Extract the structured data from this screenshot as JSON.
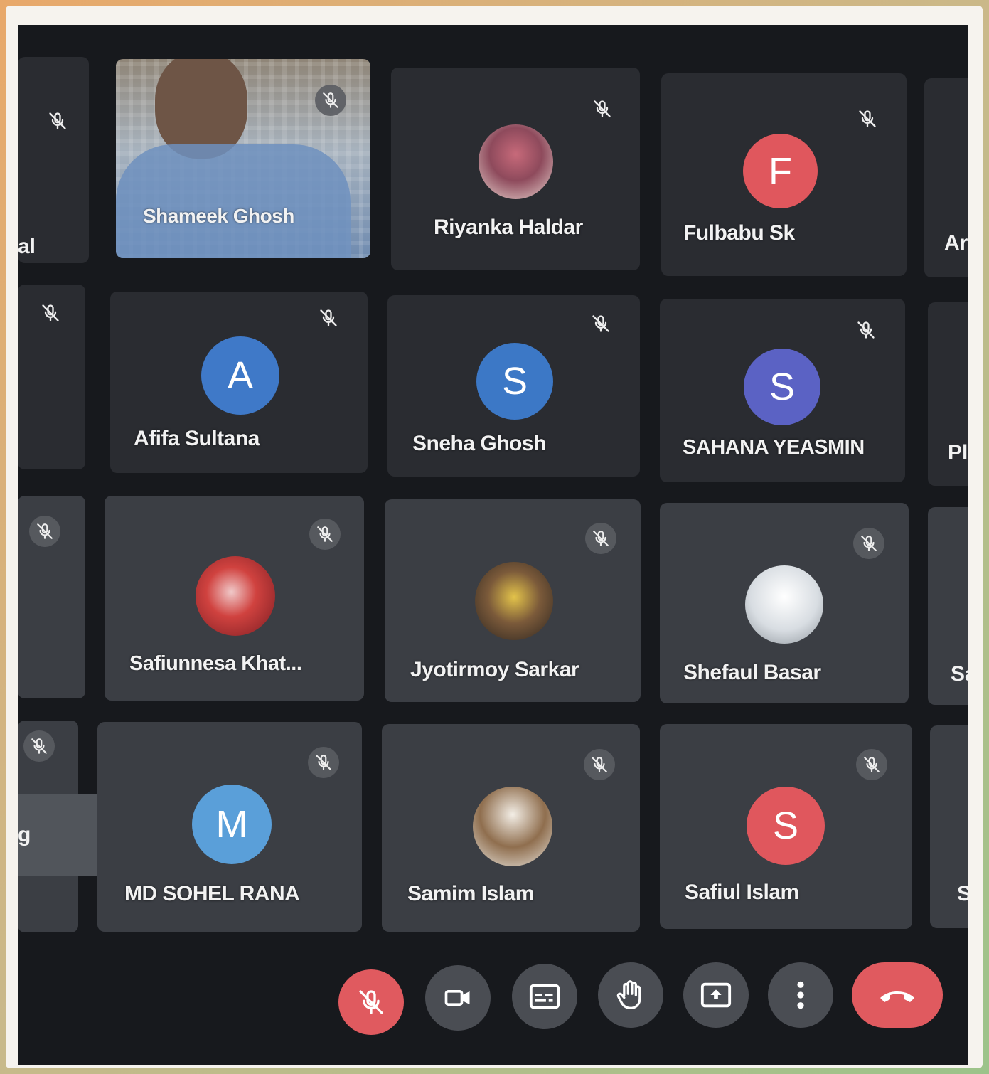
{
  "participants": [
    {
      "name": "Shameek Ghosh",
      "type": "video"
    },
    {
      "name": "Riyanka Haldar",
      "type": "photo"
    },
    {
      "name": "Fulbabu Sk",
      "type": "letter",
      "initial": "F",
      "color": "#e0575d"
    },
    {
      "name": "Afifa Sultana",
      "type": "letter",
      "initial": "A",
      "color": "#3f79c8"
    },
    {
      "name": "Sneha Ghosh",
      "type": "letter",
      "initial": "S",
      "color": "#3c78c6"
    },
    {
      "name": "SAHANA YEASMIN",
      "type": "letter",
      "initial": "S",
      "color": "#5b62c4"
    },
    {
      "name": "Safiunnesa Khat...",
      "type": "photo"
    },
    {
      "name": "Jyotirmoy Sarkar",
      "type": "photo"
    },
    {
      "name": "Shefaul Basar",
      "type": "photo"
    },
    {
      "name": "MD SOHEL RANA",
      "type": "letter",
      "initial": "M",
      "color": "#5a9fd9"
    },
    {
      "name": "Samim Islam",
      "type": "photo"
    },
    {
      "name": "Safiul Islam",
      "type": "letter",
      "initial": "S",
      "color": "#e0575d"
    }
  ],
  "partial_labels": {
    "left_top": "al",
    "right_row1": "Ar",
    "right_row2": "Pl",
    "right_row3": "Sa",
    "right_row4": "S",
    "left_row4": "g"
  },
  "controls": [
    {
      "name": "microphone-off",
      "state": "muted"
    },
    {
      "name": "camera"
    },
    {
      "name": "captions"
    },
    {
      "name": "raise-hand"
    },
    {
      "name": "present-screen"
    },
    {
      "name": "more-options"
    },
    {
      "name": "leave-call"
    }
  ],
  "colors": {
    "muted_red": "#e05a5f",
    "tile": "#3b3e44",
    "background": "#17191d"
  }
}
